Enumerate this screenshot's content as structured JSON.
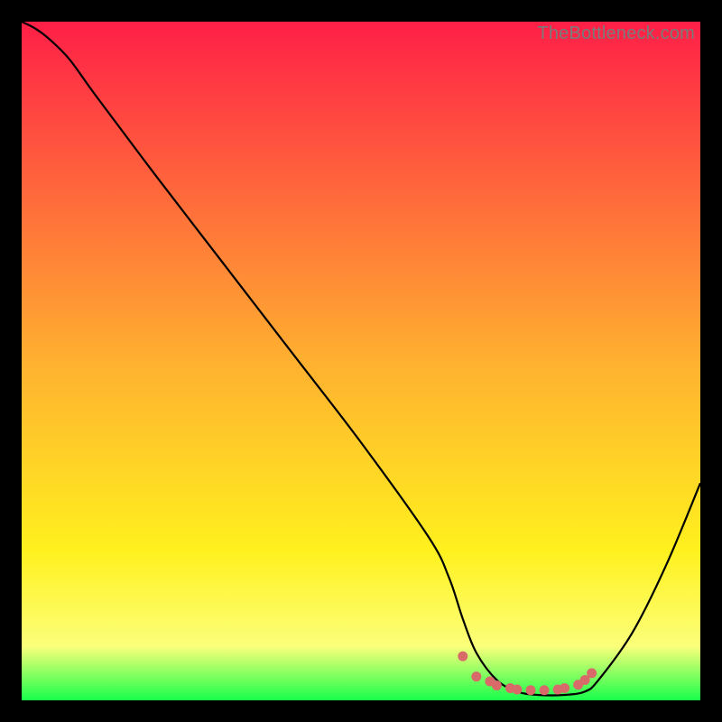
{
  "watermark": "TheBottleneck.com",
  "chart_data": {
    "type": "line",
    "title": "",
    "xlabel": "",
    "ylabel": "",
    "xlim": [
      0,
      100
    ],
    "ylim": [
      0,
      100
    ],
    "grid": false,
    "background_gradient": {
      "stops": [
        {
          "pos": 0.0,
          "color": "#ff1f47"
        },
        {
          "pos": 0.5,
          "color": "#ffb030"
        },
        {
          "pos": 0.78,
          "color": "#fff11e"
        },
        {
          "pos": 0.92,
          "color": "#fcff7a"
        },
        {
          "pos": 1.0,
          "color": "#18ff4a"
        }
      ]
    },
    "series": [
      {
        "name": "curve",
        "color": "#000000",
        "x": [
          0,
          2,
          4,
          7,
          11,
          20,
          30,
          40,
          50,
          60,
          63,
          65,
          67,
          70,
          73,
          76,
          80,
          83,
          85,
          90,
          95,
          100
        ],
        "y": [
          100,
          99,
          97.5,
          94.5,
          89,
          77,
          64,
          51,
          38,
          24,
          18,
          12,
          7,
          3,
          1.3,
          0.8,
          0.8,
          1.3,
          3,
          10,
          20,
          32
        ]
      },
      {
        "name": "dots",
        "type": "scatter",
        "color": "#d86a6a",
        "x": [
          65,
          67,
          69,
          70,
          72,
          73,
          75,
          77,
          79,
          80,
          82,
          83,
          84
        ],
        "y": [
          6.5,
          3.5,
          2.8,
          2.2,
          1.8,
          1.6,
          1.5,
          1.5,
          1.6,
          1.8,
          2.3,
          3.0,
          4.0
        ]
      }
    ]
  }
}
